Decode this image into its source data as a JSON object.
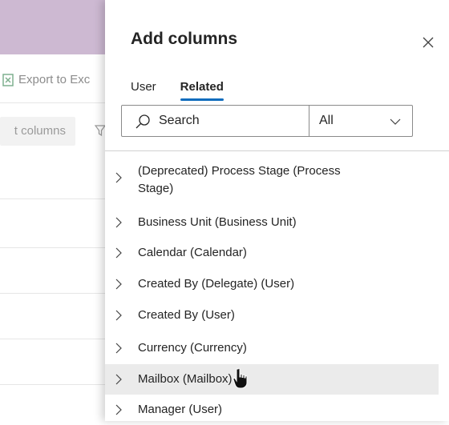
{
  "background": {
    "export_label": "Export to Exc",
    "edit_columns_label": "t columns"
  },
  "panel": {
    "title": "Add columns",
    "tabs": [
      {
        "label": "User",
        "active": false
      },
      {
        "label": "Related",
        "active": true
      }
    ],
    "search": {
      "value": "Search"
    },
    "filter": {
      "selected": "All"
    },
    "items": [
      {
        "label": "(Deprecated) Process Stage (Process Stage)",
        "label_line1": "(Deprecated) Process Stage (Process",
        "label_line2": "Stage)"
      },
      {
        "label": "Business Unit (Business Unit)"
      },
      {
        "label": "Calendar (Calendar)"
      },
      {
        "label": "Created By (Delegate) (User)"
      },
      {
        "label": "Created By (User)"
      },
      {
        "label": "Currency (Currency)"
      },
      {
        "label": "Mailbox (Mailbox)",
        "hovered": true
      },
      {
        "label": "Manager (User)"
      }
    ]
  },
  "colors": {
    "header": "#cdb9d2",
    "accent": "#0f6cbd",
    "hover": "#ebebeb"
  },
  "icons": [
    "excel-icon",
    "filter-icon",
    "close-icon",
    "search-icon",
    "chevron-down-icon",
    "chevron-right-icon",
    "hand-pointer-cursor"
  ]
}
